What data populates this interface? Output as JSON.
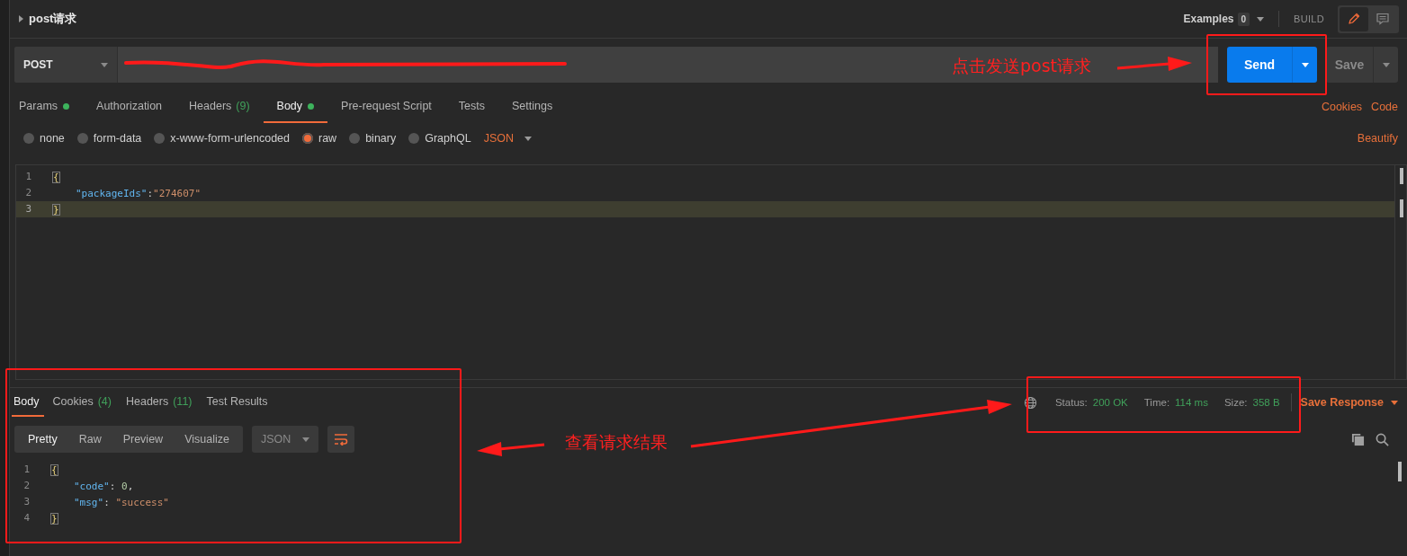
{
  "header": {
    "title": "post请求",
    "examples_label": "Examples",
    "examples_count": "0",
    "mode": "BUILD",
    "views": [
      {
        "kind": "edit",
        "selected": true
      },
      {
        "kind": "comments",
        "selected": false
      }
    ]
  },
  "request": {
    "method": "POST",
    "send": "Send",
    "save": "Save",
    "tabs": [
      {
        "label": "Params",
        "dot": true,
        "selected": false
      },
      {
        "label": "Authorization",
        "dot": false,
        "selected": false
      },
      {
        "label": "Headers",
        "count": "(9)",
        "dot": false,
        "selected": false
      },
      {
        "label": "Body",
        "dot": true,
        "selected": true
      },
      {
        "label": "Pre-request Script",
        "dot": false,
        "selected": false
      },
      {
        "label": "Tests",
        "dot": false,
        "selected": false
      },
      {
        "label": "Settings",
        "dot": false,
        "selected": false
      }
    ],
    "links": [
      "Cookies",
      "Code"
    ],
    "body_types": [
      {
        "label": "none",
        "selected": false
      },
      {
        "label": "form-data",
        "selected": false
      },
      {
        "label": "x-www-form-urlencoded",
        "selected": false
      },
      {
        "label": "raw",
        "selected": true
      },
      {
        "label": "binary",
        "selected": false
      },
      {
        "label": "GraphQL",
        "selected": false
      }
    ],
    "format": "JSON",
    "beautify": "Beautify",
    "lines": [
      {
        "number": "1",
        "active": false,
        "tokens": [
          {
            "kind": "brace",
            "text": "{"
          }
        ]
      },
      {
        "number": "2",
        "active": false,
        "tokens": [
          {
            "kind": "key",
            "text": "\"packageIds\""
          },
          {
            "kind": "punct",
            "text": ":"
          },
          {
            "kind": "string",
            "text": "\"274607\""
          }
        ]
      },
      {
        "number": "3",
        "active": true,
        "tokens": [
          {
            "kind": "brace",
            "text": "}"
          }
        ]
      }
    ]
  },
  "response": {
    "tabs": [
      {
        "label": "Body",
        "selected": true
      },
      {
        "label": "Cookies",
        "count": "(4)",
        "selected": false
      },
      {
        "label": "Headers",
        "count": "(11)",
        "selected": false
      },
      {
        "label": "Test Results",
        "selected": false
      }
    ],
    "stats": [
      {
        "label": "Status:",
        "value": "200 OK"
      },
      {
        "label": "Time:",
        "value": "114 ms"
      },
      {
        "label": "Size:",
        "value": "358 B"
      }
    ],
    "save_response": "Save Response",
    "views": [
      {
        "label": "Pretty",
        "selected": true
      },
      {
        "label": "Raw",
        "selected": false
      },
      {
        "label": "Preview",
        "selected": false
      },
      {
        "label": "Visualize",
        "selected": false
      }
    ],
    "format": "JSON",
    "wrap_on": true,
    "lines": [
      {
        "number": "1",
        "tokens": [
          {
            "kind": "brace",
            "text": "{"
          }
        ]
      },
      {
        "number": "2",
        "tokens": [
          {
            "kind": "key",
            "text": "\"code\""
          },
          {
            "kind": "punct",
            "text": ": "
          },
          {
            "kind": "number",
            "text": "0"
          },
          {
            "kind": "punct",
            "text": ","
          }
        ]
      },
      {
        "number": "3",
        "tokens": [
          {
            "kind": "key",
            "text": "\"msg\""
          },
          {
            "kind": "punct",
            "text": ": "
          },
          {
            "kind": "string",
            "text": "\"success\""
          }
        ]
      },
      {
        "number": "4",
        "tokens": [
          {
            "kind": "brace",
            "text": "}"
          }
        ]
      }
    ]
  },
  "annotations": {
    "send_note": "点击发送post请求",
    "result_note": "查看请求结果"
  }
}
